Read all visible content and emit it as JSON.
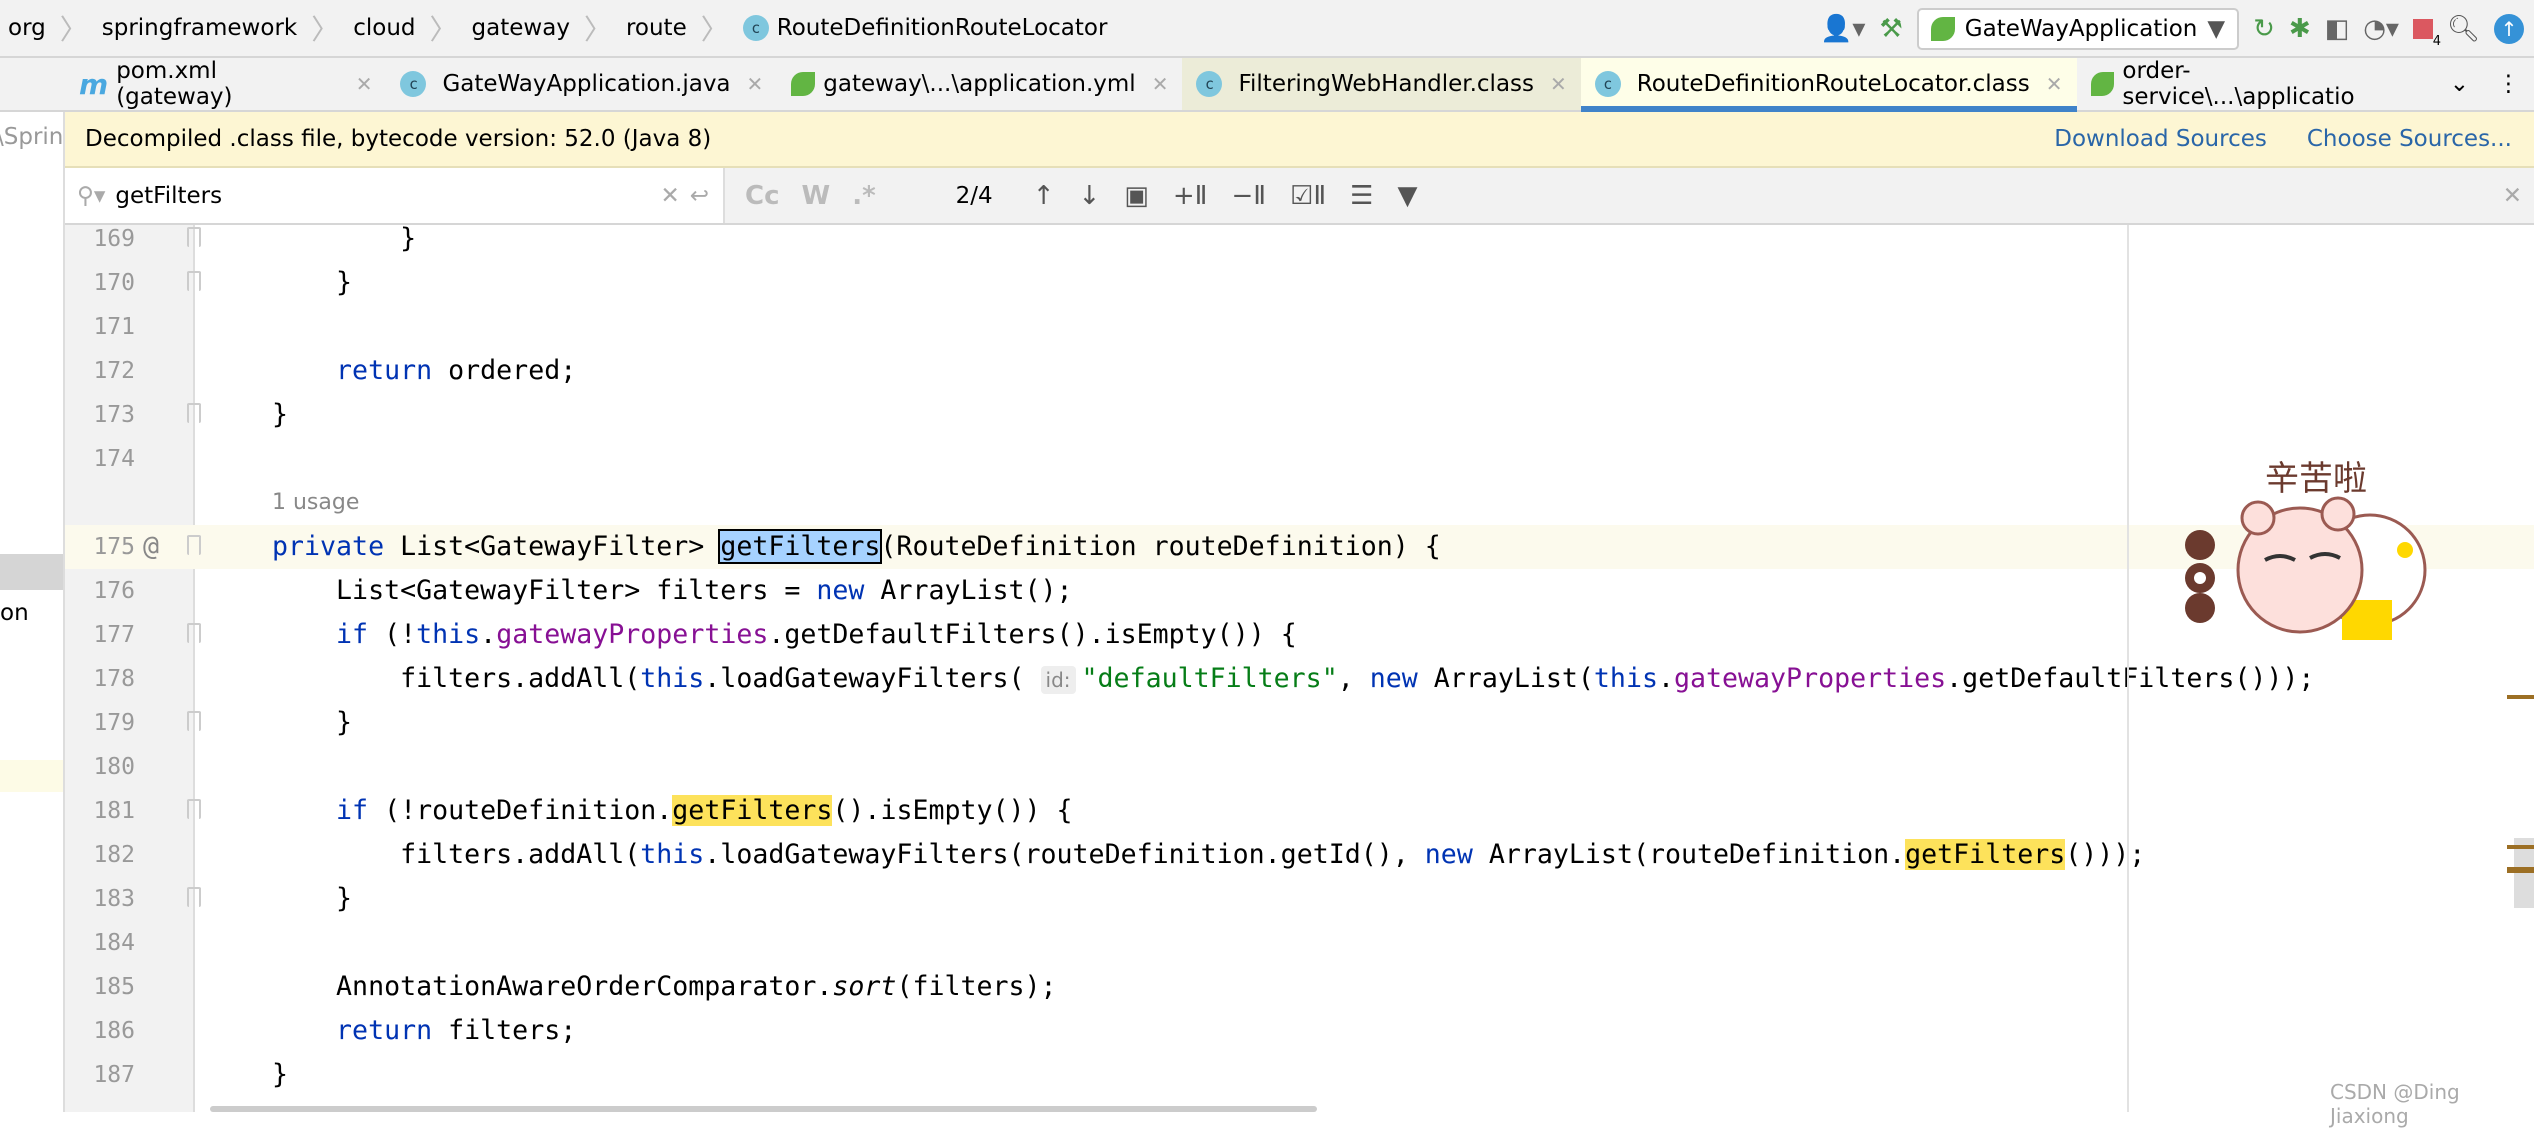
{
  "breadcrumb": [
    "org",
    "springframework",
    "cloud",
    "gateway",
    "route",
    "RouteDefinitionRouteLocator"
  ],
  "toolbar": {
    "run_config": "GateWayApplication",
    "stop_badge": "4"
  },
  "tabs": [
    {
      "label": "pom.xml (gateway)",
      "icon": "maven-icon"
    },
    {
      "label": "GateWayApplication.java",
      "icon": "spring-class-icon"
    },
    {
      "label": "gateway\\...\\application.yml",
      "icon": "spring-yml-icon"
    },
    {
      "label": "FilteringWebHandler.class",
      "icon": "class-icon"
    },
    {
      "label": "RouteDefinitionRouteLocator.class",
      "icon": "class-icon",
      "active": true
    },
    {
      "label": "order-service\\...\\applicatio",
      "icon": "spring-yml-icon"
    }
  ],
  "banner": {
    "text": "Decompiled .class file, bytecode version: 52.0 (Java 8)",
    "download": "Download Sources",
    "choose": "Choose Sources..."
  },
  "search": {
    "value": "getFilters",
    "count": "2/4",
    "case_label": "Cc",
    "word_label": "W",
    "regex_label": ".*"
  },
  "leftpanel": {
    "items": [
      "\\Spring",
      "on"
    ]
  },
  "code": {
    "lines": [
      {
        "n": "169",
        "fold": true,
        "t": [
          [
            "",
            "        }"
          ]
        ]
      },
      {
        "n": "170",
        "fold": true,
        "t": [
          [
            "",
            "    }"
          ]
        ]
      },
      {
        "n": "171",
        "t": []
      },
      {
        "n": "172",
        "t": [
          [
            "",
            "    "
          ],
          [
            "kw",
            "return"
          ],
          [
            "",
            " ordered;"
          ]
        ]
      },
      {
        "n": "173",
        "fold": true,
        "t": [
          [
            "",
            "}"
          ]
        ]
      },
      {
        "n": "174",
        "t": []
      },
      {
        "usage": "1 usage"
      },
      {
        "n": "175",
        "ann": "@",
        "fold": true,
        "cur": true,
        "t": [
          [
            "kw",
            "private"
          ],
          [
            "",
            " List<GatewayFilter> "
          ],
          [
            "sel",
            "getFilters"
          ],
          [
            "",
            "(RouteDefinition routeDefinition) {"
          ]
        ]
      },
      {
        "n": "176",
        "t": [
          [
            "",
            "    List<GatewayFilter> filters = "
          ],
          [
            "kw",
            "new"
          ],
          [
            "",
            " ArrayList();"
          ]
        ]
      },
      {
        "n": "177",
        "fold": true,
        "t": [
          [
            "",
            "    "
          ],
          [
            "kw",
            "if"
          ],
          [
            "",
            " (!"
          ],
          [
            "kw",
            "this"
          ],
          [
            "",
            "."
          ],
          [
            "fld",
            "gatewayProperties"
          ],
          [
            "",
            ".getDefaultFilters().isEmpty()) {"
          ]
        ]
      },
      {
        "n": "178",
        "t": [
          [
            "",
            "        filters.addAll("
          ],
          [
            "kw",
            "this"
          ],
          [
            "",
            ".loadGatewayFilters( "
          ],
          [
            "hint",
            "id:"
          ],
          [
            "str",
            "\"defaultFilters\""
          ],
          [
            "",
            ", "
          ],
          [
            "kw",
            "new"
          ],
          [
            "",
            " ArrayList("
          ],
          [
            "kw",
            "this"
          ],
          [
            "",
            "."
          ],
          [
            "fld",
            "gatewayProperties"
          ],
          [
            "",
            ".getDefaultFilters()));"
          ]
        ]
      },
      {
        "n": "179",
        "fold": true,
        "t": [
          [
            "",
            "    }"
          ]
        ]
      },
      {
        "n": "180",
        "t": []
      },
      {
        "n": "181",
        "fold": true,
        "t": [
          [
            "",
            "    "
          ],
          [
            "kw",
            "if"
          ],
          [
            "",
            " (!routeDefinition."
          ],
          [
            "match",
            "getFilters"
          ],
          [
            "",
            "().isEmpty()) {"
          ]
        ]
      },
      {
        "n": "182",
        "t": [
          [
            "",
            "        filters.addAll("
          ],
          [
            "kw",
            "this"
          ],
          [
            "",
            ".loadGatewayFilters(routeDefinition.getId(), "
          ],
          [
            "kw",
            "new"
          ],
          [
            "",
            " ArrayList(routeDefinition."
          ],
          [
            "match",
            "getFilters"
          ],
          [
            "",
            "()));"
          ]
        ]
      },
      {
        "n": "183",
        "fold": true,
        "t": [
          [
            "",
            "    }"
          ]
        ]
      },
      {
        "n": "184",
        "t": []
      },
      {
        "n": "185",
        "t": [
          [
            "",
            "    AnnotationAwareOrderComparator."
          ],
          [
            "it",
            "sort"
          ],
          [
            "",
            "(filters);"
          ]
        ]
      },
      {
        "n": "186",
        "t": [
          [
            "",
            "    "
          ],
          [
            "kw",
            "return"
          ],
          [
            "",
            " filters;"
          ]
        ]
      },
      {
        "n": "187",
        "t": [
          [
            "",
            "}"
          ]
        ]
      }
    ]
  },
  "sticker": {
    "text": "辛苦啦"
  },
  "watermark": "CSDN @Ding Jiaxiong",
  "colors": {
    "keyword": "#0033b3",
    "field": "#871094",
    "string": "#067d17",
    "match": "#fde25b",
    "selected_match": "#a6d2ff",
    "accent": "#4083c9"
  }
}
